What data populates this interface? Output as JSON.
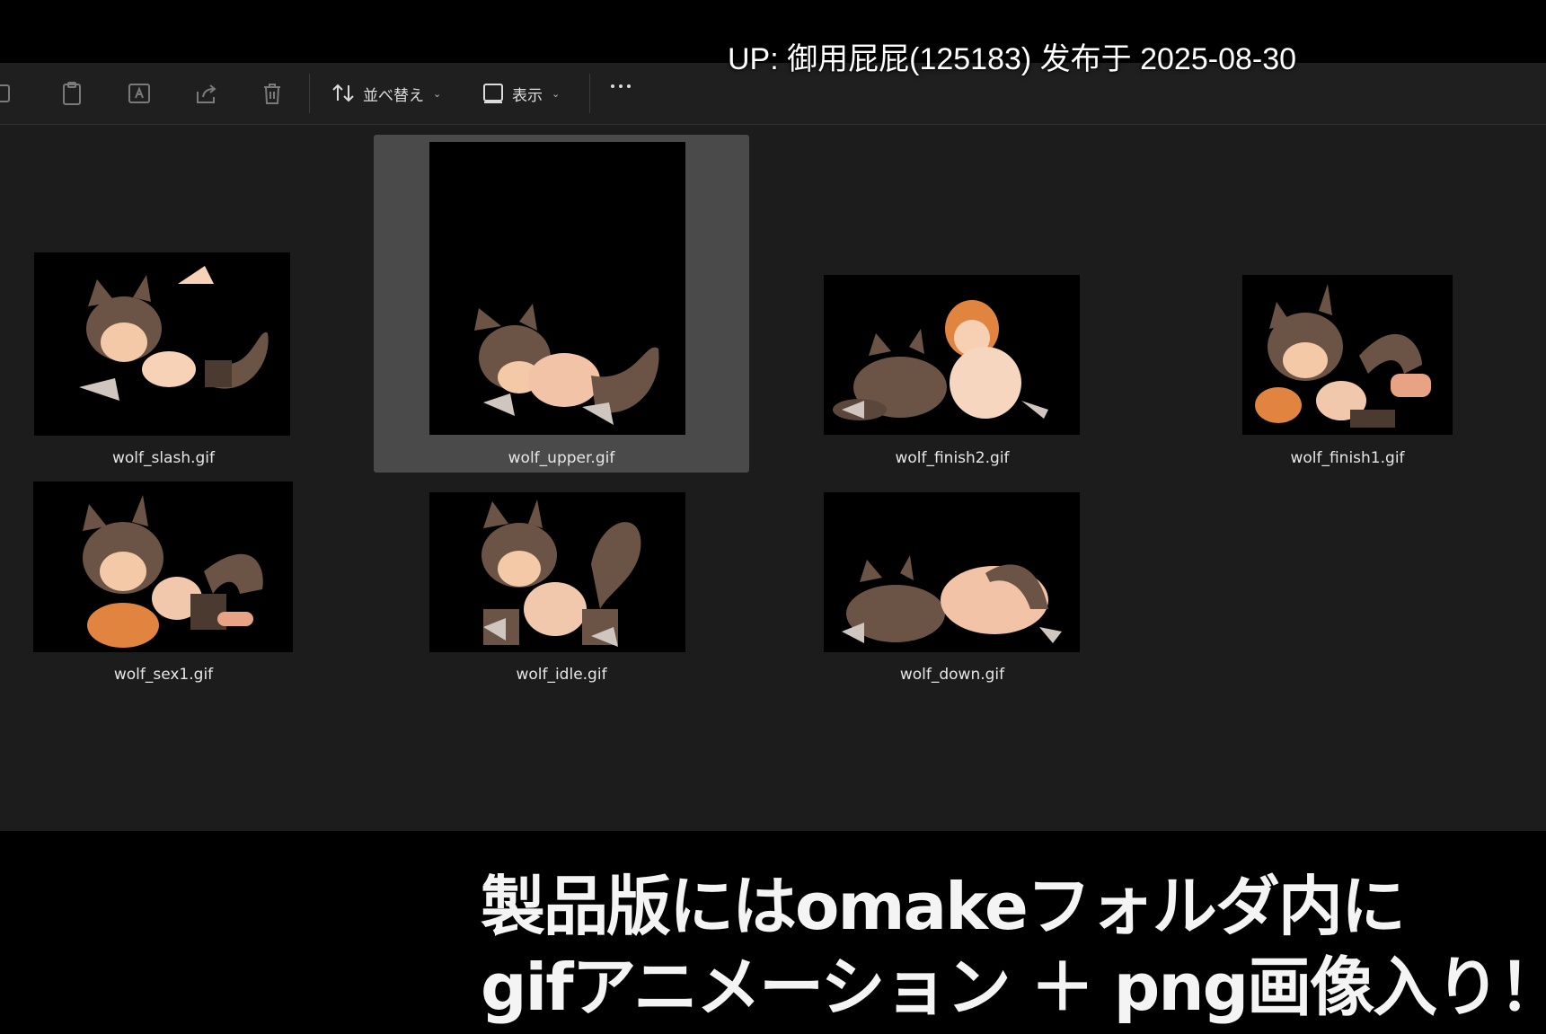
{
  "overlay": {
    "uploader_text": "UP: 御用屁屁(125183) 发布于 2025-08-30"
  },
  "toolbar": {
    "sort_label": "並べ替え",
    "view_label": "表示",
    "icons": [
      "copy-icon",
      "paste-icon",
      "rename-icon",
      "share-icon",
      "delete-icon",
      "sort-icon",
      "view-icon",
      "more-icon"
    ]
  },
  "files": [
    {
      "name": "wolf_slash.gif",
      "selected": false
    },
    {
      "name": "wolf_upper.gif",
      "selected": true
    },
    {
      "name": "wolf_finish2.gif",
      "selected": false
    },
    {
      "name": "wolf_finish1.gif",
      "selected": false
    },
    {
      "name": "wolf_sex1.gif",
      "selected": false
    },
    {
      "name": "wolf_idle.gif",
      "selected": false
    },
    {
      "name": "wolf_down.gif",
      "selected": false
    }
  ],
  "promo": {
    "line1": "製品版にはomakeフォルダ内に",
    "line2": "gifアニメーション ＋ png画像入り！"
  }
}
